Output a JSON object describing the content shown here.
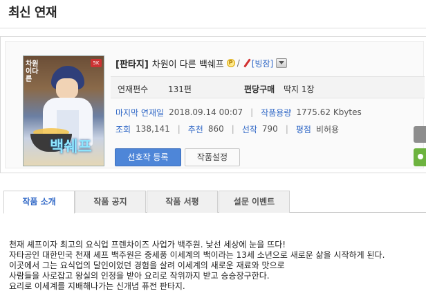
{
  "section_title": "최신 연재",
  "work": {
    "genre": "[판타지]",
    "name": "차원이 다른 백쉐프",
    "premium_icon": "P",
    "slash": "/",
    "author": "[빙잠]"
  },
  "meta": {
    "episodes_label": "연재편수",
    "episodes_value": "131편",
    "price_label": "편당구매",
    "price_value": "딱지 1장",
    "last_label": "마지막 연재일",
    "last_value": "2018.09.14 00:07",
    "size_label": "작품용량",
    "size_value": "1775.62 Kbytes",
    "views_label": "조회",
    "views_value": "138,141",
    "recommend_label": "추천",
    "recommend_value": "860",
    "picks_label": "선작",
    "picks_value": "790",
    "rating_label": "평점",
    "rating_value": "비허용",
    "separator": "|"
  },
  "buttons": {
    "favorite": "선호작 등록",
    "settings": "작품설정"
  },
  "tabs": [
    {
      "label": "작품 소개",
      "active": true
    },
    {
      "label": "작품 공지",
      "active": false
    },
    {
      "label": "작품 서평",
      "active": false
    },
    {
      "label": "설문 이벤트",
      "active": false
    }
  ],
  "synopsis": [
    "천재 셰프이자 최고의 요식업 프렌차이즈 사업가 백주원. 낯선 세상에 눈을 뜨다!",
    "자타공인 대한민국 천재 셰프 백주원은 중세풍 이세계의 백이라는 13세 소년으로 새로운 삶을 시작하게 된다.",
    "이곳에서 그는 요식업의 달인이었던 경험을 살려 이세계의 새로운 재료와 맛으로",
    "사람들을 사로잡고 왕실의 인정을 받아 요리로 작위까지 받고 승승장구한다.",
    "요리로 이세계를 지배해나가는 신개념 퓨전 판타지."
  ],
  "cover": {
    "title_text": "차원이다른",
    "big_text": "백쉐프",
    "badge": "5K"
  },
  "colors": {
    "accent_blue": "#2f67c6",
    "button_blue": "#4e86d8",
    "side_green": "#6db33f"
  },
  "icons": [
    "premium-icon",
    "pen-icon",
    "dropdown-icon"
  ]
}
